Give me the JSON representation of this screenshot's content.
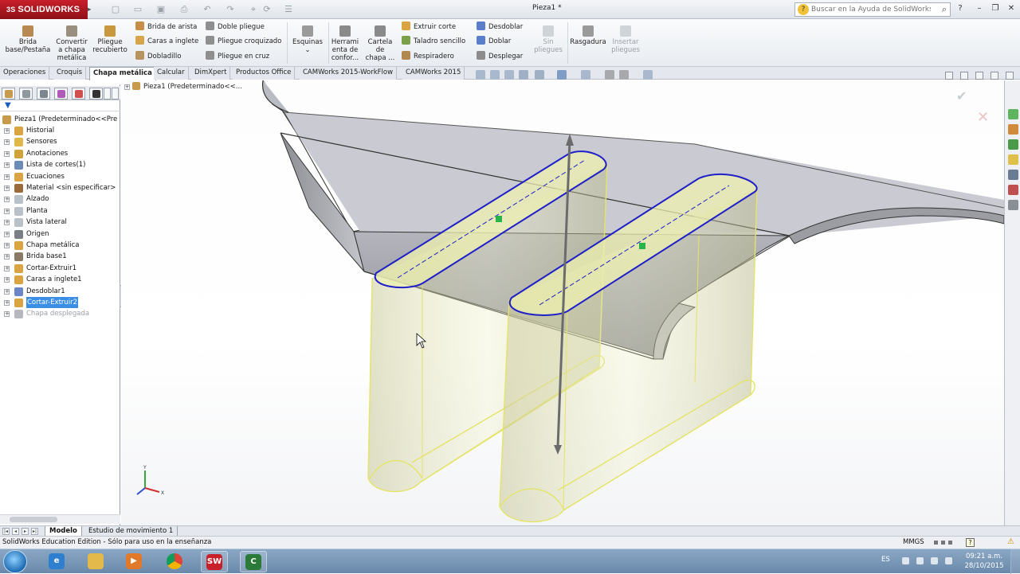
{
  "app": {
    "logo": "SOLIDWORKS",
    "document_title": "Pieza1 *",
    "help_search_placeholder": "Buscar en la Ayuda de SolidWorks"
  },
  "ribbon": {
    "big_buttons": [
      {
        "label": "Brida base/Pestaña",
        "line1": "Brida",
        "line2": "base/Pestaña",
        "line3": ""
      },
      {
        "label": "Convertir a chapa metálica",
        "line1": "Convertir",
        "line2": "a chapa",
        "line3": "metálica"
      },
      {
        "label": "Pliegue recubierto",
        "line1": "Pliegue",
        "line2": "recubierto",
        "line3": ""
      }
    ],
    "small_col1": [
      "Brida de arista",
      "Caras a inglete",
      "Dobladillo"
    ],
    "small_col2": [
      "Doble pliegue",
      "Pliegue croquizado",
      "Pliegue en cruz"
    ],
    "esquinas": "Esquinas",
    "herramienta": {
      "line1": "Herrami",
      "line2": "enta de",
      "line3": "confor..."
    },
    "cartela": {
      "line1": "Cartela",
      "line2": "de",
      "line3": "chapa ..."
    },
    "small_col3": [
      "Extruir corte",
      "Taladro sencillo",
      "Respiradero"
    ],
    "small_col4": [
      "Desdoblar",
      "Doblar",
      "Desplegar"
    ],
    "sin_pliegues": {
      "line1": "Sin",
      "line2": "pliegues"
    },
    "rasgadura": "Rasgadura",
    "insertar_pliegues": {
      "line1": "Insertar",
      "line2": "pliegues"
    }
  },
  "tabs": [
    "Operaciones",
    "Croquis",
    "Chapa metálica",
    "Calcular",
    "DimXpert",
    "Productos Office",
    "CAMWorks 2015-WorkFlow",
    "CAMWorks 2015"
  ],
  "active_tab": "Chapa metálica",
  "feature_tree": {
    "root": "Pieza1  (Predeterminado<<Pre",
    "items": [
      {
        "label": "Historial",
        "icon": "history-icon",
        "color": "#d9a441"
      },
      {
        "label": "Sensores",
        "icon": "sensor-icon",
        "color": "#e0b84a"
      },
      {
        "label": "Anotaciones",
        "icon": "annotation-icon",
        "color": "#d0a33a"
      },
      {
        "label": "Lista de cortes(1)",
        "icon": "cutlist-icon",
        "color": "#6c8cb8"
      },
      {
        "label": "Ecuaciones",
        "icon": "equation-icon",
        "color": "#d9a441"
      },
      {
        "label": "Material <sin especificar>",
        "icon": "material-icon",
        "color": "#9a6a3a"
      },
      {
        "label": "Alzado",
        "icon": "plane-icon",
        "color": "#b8c0c8"
      },
      {
        "label": "Planta",
        "icon": "plane-icon",
        "color": "#b8c0c8"
      },
      {
        "label": "Vista lateral",
        "icon": "plane-icon",
        "color": "#b8c0c8"
      },
      {
        "label": "Origen",
        "icon": "origin-icon",
        "color": "#7a7f86"
      },
      {
        "label": "Chapa metálica",
        "icon": "sheetmetal-icon",
        "color": "#d9a441"
      },
      {
        "label": "Brida base1",
        "icon": "baseflange-icon",
        "color": "#8a7a66"
      },
      {
        "label": "Cortar-Extruir1",
        "icon": "cutextrude-icon",
        "color": "#d9a441"
      },
      {
        "label": "Caras a inglete1",
        "icon": "miter-icon",
        "color": "#d9a441"
      },
      {
        "label": "Desdoblar1",
        "icon": "unfold-icon",
        "color": "#6a86c8"
      },
      {
        "label": "Cortar-Extruir2",
        "icon": "cutextrude-icon",
        "color": "#d9a441"
      },
      {
        "label": "Chapa desplegada",
        "icon": "flatpattern-icon",
        "color": "#b5b9be"
      }
    ],
    "selected": "Cortar-Extruir2",
    "greyed": "Chapa desplegada"
  },
  "viewport": {
    "tree_overlay": "Pieza1  (Predeterminado<<..."
  },
  "bottom_tabs": [
    "Modelo",
    "Estudio de movimiento 1"
  ],
  "status": {
    "text": "SolidWorks Education Edition - Sólo para uso en la enseñanza",
    "units": "MMGS",
    "help": "?"
  },
  "taskbar": {
    "language": "ES",
    "time": "09:21 a.m.",
    "date": "28/10/2015"
  },
  "colors": {
    "brand_red": "#b3171f",
    "selection_blue": "#1f1fc8",
    "preview_yellow": "#f2f06a"
  }
}
